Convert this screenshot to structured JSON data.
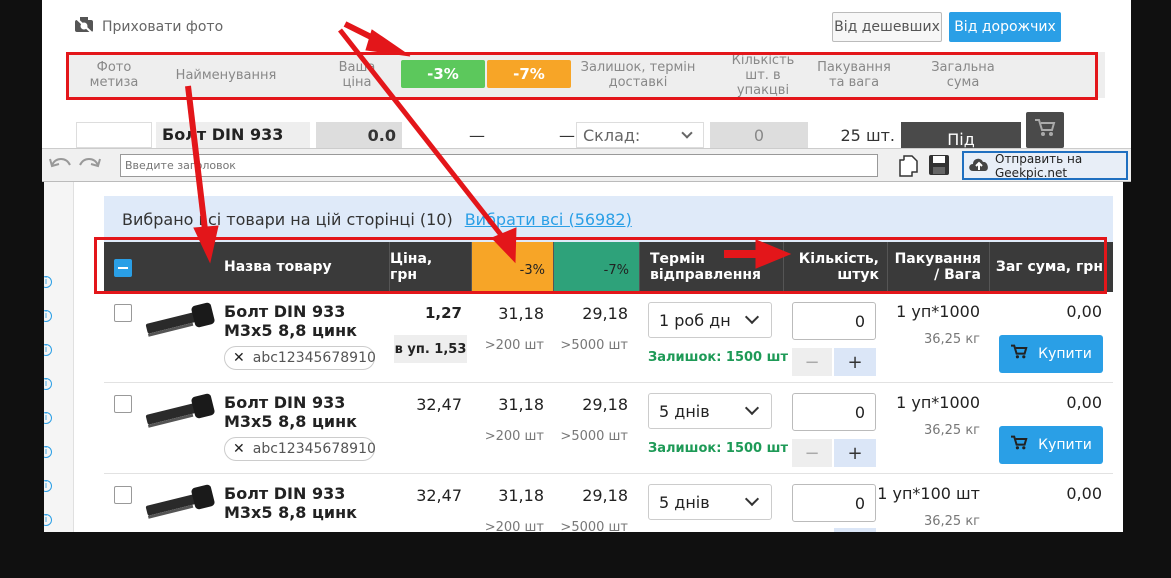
{
  "top_panel": {
    "hide_photo": "Приховати фото",
    "sort_cheap": "Від дешевших",
    "sort_expensive": "Від дорожчих",
    "header": {
      "photo": "Фото метиза",
      "name": "Найменування",
      "your_price": "Ваша ціна",
      "disc3": "-3%",
      "disc7": "-7%",
      "stock": "Залишок, термін доставкі",
      "qty_pack": "Кількість шт. в упакцві",
      "pack_weight": "Пакування та вага",
      "total": "Загальна сума"
    },
    "row": {
      "name": "Болт DIN 933",
      "price": "0.0",
      "dash1": "—",
      "dash2": "—",
      "warehouse": "Склад:",
      "qty": "0",
      "pack": "25 шт.",
      "btn": "Під"
    }
  },
  "toolbar": {
    "title_placeholder": "Введите заголовок",
    "upload": "Отправить на Geekpic.net"
  },
  "colors": {
    "blue": "#2a9fe6",
    "green": "#5cc85c",
    "orange": "#f7a527",
    "red": "#e3161a",
    "dark_header": "#3a3a3a"
  },
  "selection": {
    "text": "Вибрано всі товари на цій сторінці (10)",
    "select_all": "Вибрати всі (56982)"
  },
  "table": {
    "headers": {
      "name": "Назва товару",
      "price": "Ціна, грн",
      "disc3": "-3%",
      "disc7": "-7%",
      "ship": "Термін відправлення",
      "qty": "Кількість, штук",
      "pack": "Пакування / Вага",
      "total": "Заг сума, грн"
    },
    "rows": [
      {
        "name": "Болт DIN 933 М3х5 8,8 цинк",
        "tag": "abc12345678910",
        "price": "1,27",
        "price_note": "в уп. 1,53",
        "p3": "31,18",
        "p3_note": ">200 шт",
        "p7": "29,18",
        "p7_note": ">5000 шт",
        "ship": "1 роб дн",
        "stock": "Залишок: 1500 шт",
        "qty": "0",
        "minus": "−",
        "plus": "+",
        "pack": "1 уп*1000",
        "weight": "36,25 кг",
        "total": "0,00",
        "buy": "Купити"
      },
      {
        "name": "Болт DIN 933 М3х5 8,8 цинк",
        "tag": "abc12345678910",
        "price": "32,47",
        "p3": "31,18",
        "p3_note": ">200 шт",
        "p7": "29,18",
        "p7_note": ">5000 шт",
        "ship": "5 днів",
        "stock": "Залишок: 1500 шт",
        "qty": "0",
        "minus": "−",
        "plus": "+",
        "pack": "1 уп*1000",
        "weight": "36,25 кг",
        "total": "0,00",
        "buy": "Купити"
      },
      {
        "name": "Болт DIN 933 М3х5 8,8 цинк",
        "price": "32,47",
        "p3": "31,18",
        "p3_note": ">200 шт",
        "p7": "29,18",
        "p7_note": ">5000 шт",
        "ship": "5 днів",
        "qty": "0",
        "pack": "1 уп*100 шт",
        "weight": "36,25 кг",
        "total": "0,00"
      }
    ]
  }
}
